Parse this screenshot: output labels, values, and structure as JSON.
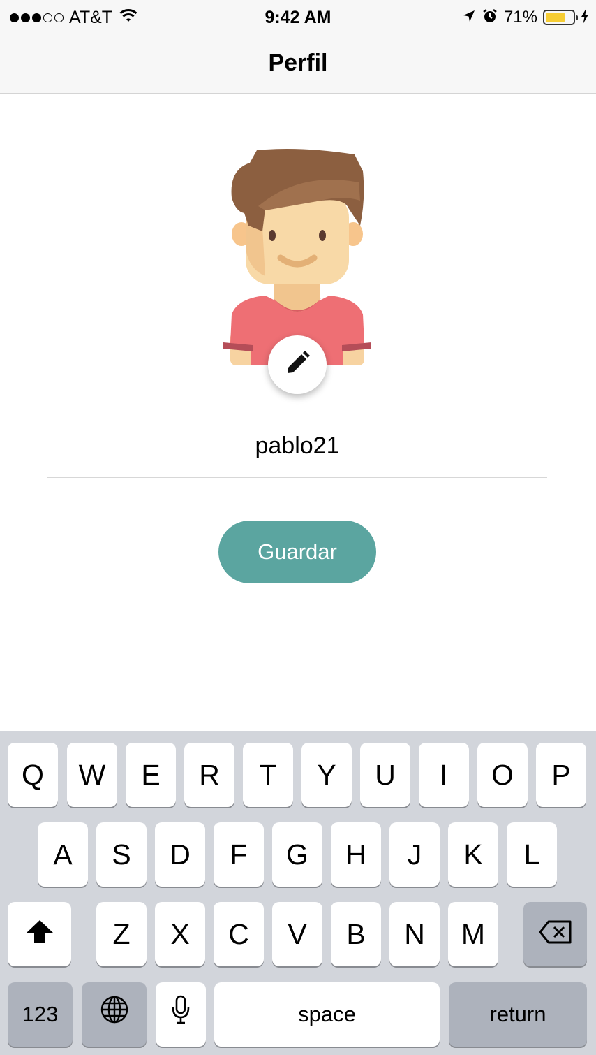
{
  "status_bar": {
    "carrier": "AT&T",
    "time": "9:42 AM",
    "battery_percent": "71%",
    "battery_level": 0.71,
    "signal_bars_filled": 3,
    "signal_bars_total": 5
  },
  "nav": {
    "title": "Perfil"
  },
  "profile": {
    "username": "pablo21",
    "save_label": "Guardar",
    "edit_icon": "pencil-icon"
  },
  "colors": {
    "accent": "#5ba5a0",
    "hair": "#8c5f40",
    "skin": "#f7d8a8",
    "shirt": "#ee6f74",
    "keyboard_bg": "#d2d5db"
  },
  "keyboard": {
    "row1": [
      "Q",
      "W",
      "E",
      "R",
      "T",
      "Y",
      "U",
      "I",
      "O",
      "P"
    ],
    "row2": [
      "A",
      "S",
      "D",
      "F",
      "G",
      "H",
      "J",
      "K",
      "L"
    ],
    "row3": [
      "Z",
      "X",
      "C",
      "V",
      "B",
      "N",
      "M"
    ],
    "numbers_label": "123",
    "space_label": "space",
    "return_label": "return",
    "shift_icon": "shift-icon",
    "delete_icon": "delete-icon",
    "globe_icon": "globe-icon",
    "mic_icon": "microphone-icon"
  }
}
